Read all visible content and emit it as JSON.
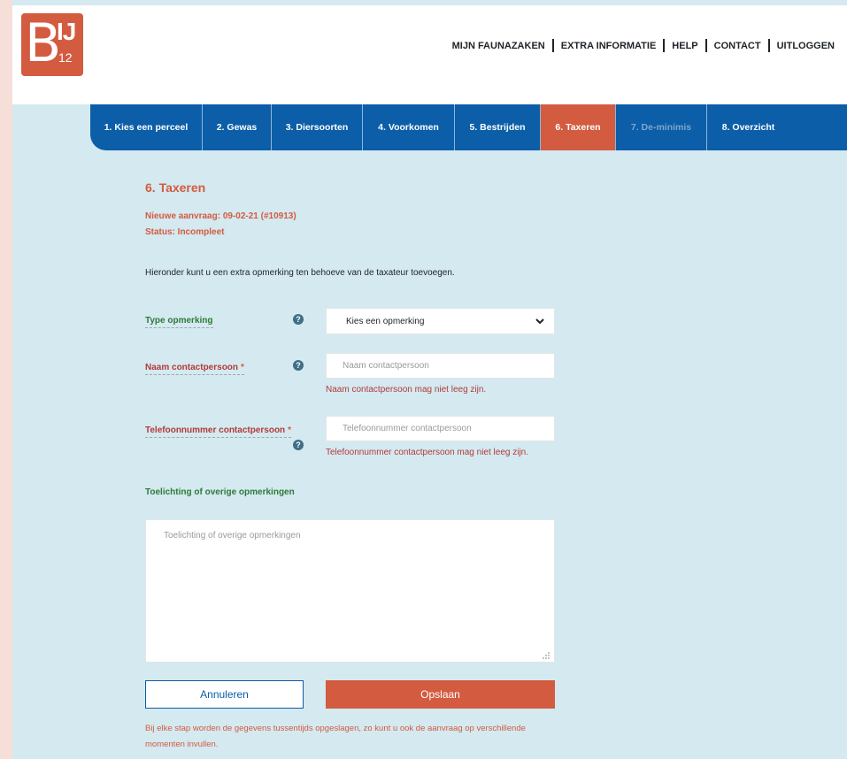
{
  "header": {
    "logo_main": "B",
    "logo_ij": "IJ",
    "logo_num": "12",
    "nav": [
      "MIJN FAUNAZAKEN",
      "EXTRA INFORMATIE",
      "HELP",
      "CONTACT",
      "UITLOGGEN"
    ]
  },
  "steps": [
    {
      "label": "1. Kies een perceel",
      "state": "done"
    },
    {
      "label": "2. Gewas",
      "state": "done"
    },
    {
      "label": "3. Diersoorten",
      "state": "done"
    },
    {
      "label": "4. Voorkomen",
      "state": "done"
    },
    {
      "label": "5. Bestrijden",
      "state": "done"
    },
    {
      "label": "6. Taxeren",
      "state": "active"
    },
    {
      "label": "7. De-minimis",
      "state": "disabled"
    },
    {
      "label": "8. Overzicht",
      "state": "done"
    }
  ],
  "main": {
    "title": "6. Taxeren",
    "request": "Nieuwe aanvraag: 09-02-21 (#10913)",
    "status": "Status: Incompleet",
    "intro": "Hieronder kunt u een extra opmerking ten behoeve van de taxateur toevoegen."
  },
  "form": {
    "type_label": "Type opmerking",
    "type_value": "Kies een opmerking",
    "name_label": "Naam contactpersoon",
    "name_placeholder": "Naam contactpersoon",
    "name_error": "Naam contactpersoon mag niet leeg zijn.",
    "phone_label": "Telefoonnummer contactpersoon",
    "phone_placeholder": "Telefoonnummer contactpersoon",
    "phone_error": "Telefoonnummer contactpersoon mag niet leeg zijn.",
    "required_mark": "*",
    "help_glyph": "?",
    "remarks_label": "Toelichting of overige opmerkingen",
    "remarks_placeholder": "Toelichting of overige opmerkingen"
  },
  "actions": {
    "cancel_label": "Annuleren",
    "save_label": "Opslaan",
    "footnote": "Bij elke stap worden de gegevens tussentijds opgeslagen, zo kunt u ook de aanvraag op verschillende momenten invullen."
  },
  "colors": {
    "brand": "#d35b40",
    "nav_blue": "#0b5ea7",
    "background": "#d4e9f0"
  }
}
